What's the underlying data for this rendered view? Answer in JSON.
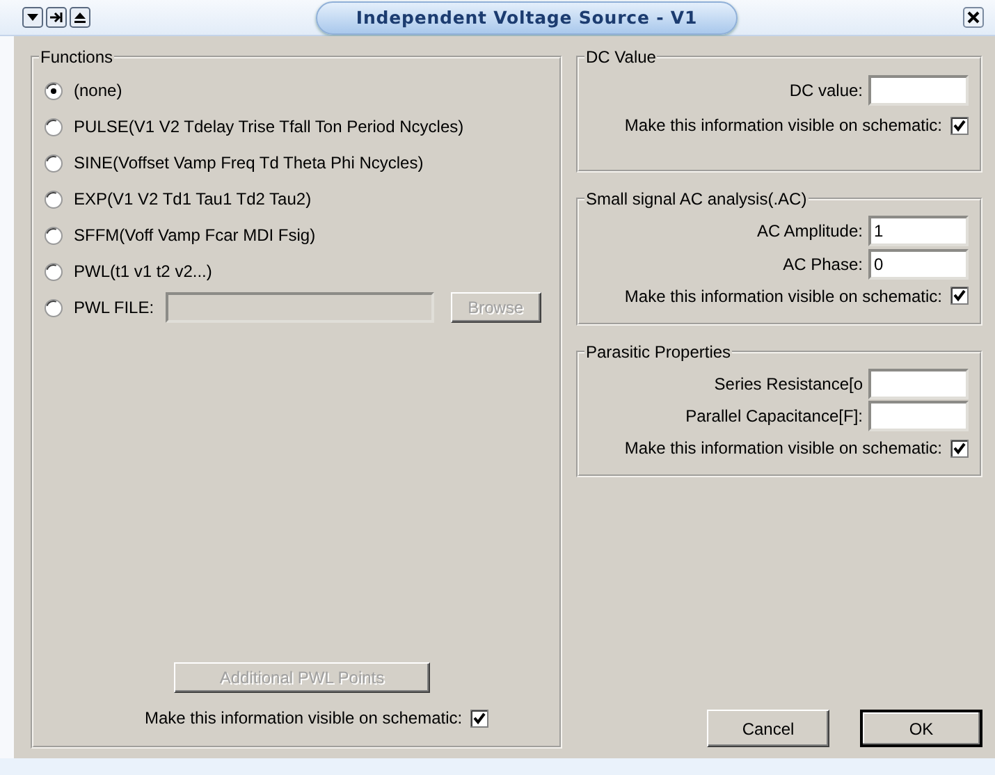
{
  "window": {
    "title": "Independent Voltage Source - V1"
  },
  "functions": {
    "label": "Functions",
    "options": [
      {
        "label": "(none)",
        "kind": "plain",
        "selected": true
      },
      {
        "label": "PULSE(V1 V2 Tdelay Trise Tfall Ton Period Ncycles)",
        "kind": "plain",
        "selected": false
      },
      {
        "label": "SINE(Voffset Vamp Freq Td Theta Phi Ncycles)",
        "kind": "plain",
        "selected": false
      },
      {
        "label": "EXP(V1 V2 Td1 Tau1 Td2 Tau2)",
        "kind": "plain",
        "selected": false
      },
      {
        "label": "SFFM(Voff Vamp Fcar MDI Fsig)",
        "kind": "plain",
        "selected": false
      },
      {
        "label": "PWL(t1 v1 t2 v2...)",
        "kind": "plain",
        "selected": false
      },
      {
        "label": "PWL FILE:",
        "kind": "file",
        "selected": false,
        "field_disabled": true,
        "button": {
          "label": "Browse",
          "disabled": true
        }
      }
    ],
    "points_button": {
      "label": "Additional PWL Points",
      "disabled": true
    },
    "visible": {
      "label": "Make this information visible on schematic:",
      "checked": true
    }
  },
  "dc_value": {
    "label": "DC Value",
    "fields": [
      {
        "label": "DC value:"
      }
    ],
    "visible": {
      "label": "Make this information visible on schematic:",
      "checked": true
    }
  },
  "ac_analysis": {
    "label": "Small signal AC analysis(.AC)",
    "fields": [
      {
        "label": "AC Amplitude:",
        "value": "1"
      },
      {
        "label": "AC Phase:",
        "value": "0"
      }
    ],
    "visible": {
      "label": "Make this information visible on schematic:",
      "checked": true
    }
  },
  "parasitic": {
    "label": "Parasitic Properties",
    "fields": [
      {
        "label": "Series Resistance[o"
      },
      {
        "label": "Parallel Capacitance[F]:"
      }
    ],
    "visible": {
      "label": "Make this information visible on schematic:",
      "checked": true
    }
  },
  "buttons": [
    {
      "label": "Cancel",
      "default": false
    },
    {
      "label": "OK",
      "default": true
    }
  ]
}
